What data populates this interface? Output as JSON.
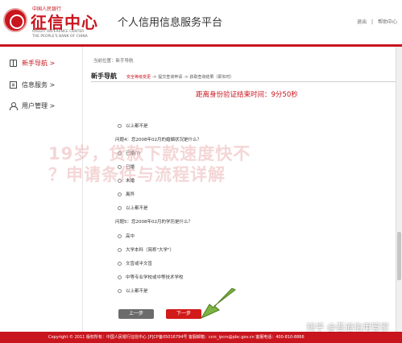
{
  "header": {
    "logo_top": "中国人民银行",
    "logo_cn": "征信中心",
    "logo_en1": "CREDIT REFERENCE CENTER",
    "logo_en2": "THE PEOPLE'S BANK OF CHINA",
    "site_title": "个人信用信息服务平台",
    "links": [
      "退出",
      "帮助中心"
    ],
    "link_sep": "|"
  },
  "sidebar": {
    "items": [
      {
        "label": "新手导航 >",
        "active": true
      },
      {
        "label": "信息服务 >",
        "active": false
      },
      {
        "label": "用户管理 >",
        "active": false
      }
    ]
  },
  "main": {
    "breadcrumb": "当前位置：新手导航",
    "section_title": "新手导航",
    "steps": {
      "current": "安全等级变更",
      "rest": " -> 提交查询申请 -> 获取查询结果（即实时）"
    },
    "timer": "距离身份验证结束时间：9分50秒",
    "q_prev_last_option": "以上都不是",
    "q4": {
      "text": "问题4：您2008年02月的婚姻状况是什么？",
      "options": [
        "已婚(?)",
        "已婚",
        "未婚",
        "离异",
        "以上都不是"
      ]
    },
    "q5": {
      "text": "问题5：您2008年02月的学历是什么？",
      "options": [
        "高中",
        "大学本科（简称\"大学\"）",
        "文盲或半文盲",
        "中等专业学校或中等技术学校",
        "以上都不是"
      ]
    },
    "btn_prev": "上一步",
    "btn_next": "下一步"
  },
  "footer": {
    "text": "Copyright © 2011   版权所有：中国人民银行征信中心   [P]CP备05016794号         客服邮箱：ccrc_ipcrs@pbc.gov.cn   客服电话：400-810-8866"
  },
  "overlay": {
    "line1": "19岁，贷款下款速度快不",
    "line2": "？申请条件与流程详解"
  },
  "watermark": "知乎 @吾道信用管家",
  "colors": {
    "brand": "#c9151e",
    "prev_button": "#6b6b6b",
    "next_button": "#d11a1a",
    "arrow": "#7cb342"
  }
}
